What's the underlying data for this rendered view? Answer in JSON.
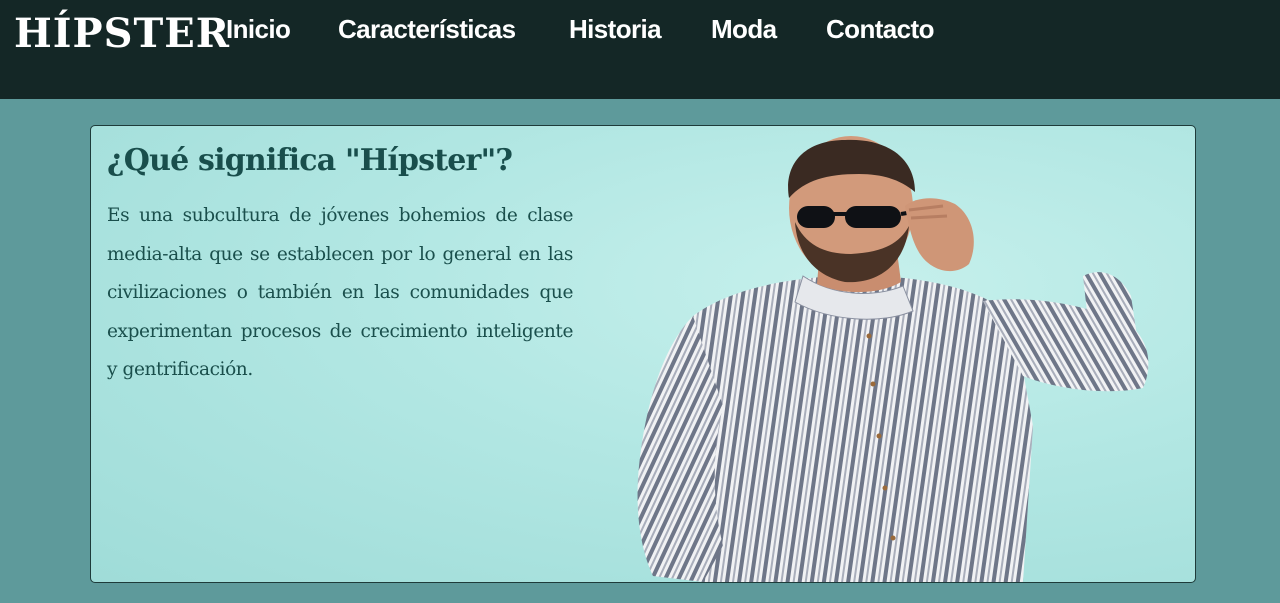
{
  "brand": {
    "logo_text": "HÍPSTER"
  },
  "nav": {
    "items": [
      {
        "label": "Inicio"
      },
      {
        "label": "Características"
      },
      {
        "label": "Historia"
      },
      {
        "label": "Moda"
      },
      {
        "label": "Contacto"
      }
    ]
  },
  "main": {
    "title": "¿Qué significa \"Hípster\"?",
    "description": "Es una subcultura de jóvenes bohemios de clase media-alta que se establecen por lo general en las civilizaciones o también en las comunidades que experimentan procesos de crecimiento inteligente y gentrificación."
  },
  "colors": {
    "header_bg": "#142726",
    "page_bg": "#5e9a9b",
    "card_bg": "#b2e7e3",
    "heading_text": "#194e4c"
  }
}
